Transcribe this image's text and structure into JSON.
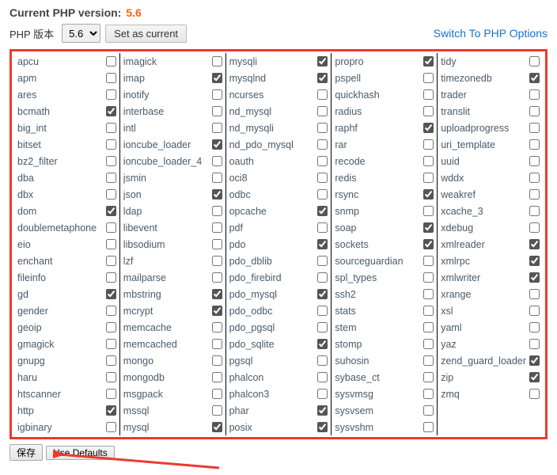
{
  "header": {
    "label": "Current PHP version:",
    "version": "5.6"
  },
  "second": {
    "label": "PHP 版本",
    "select_value": "5.6",
    "set_btn": "Set as current"
  },
  "switch_link": "Switch To PHP Options",
  "footer": {
    "save": "保存",
    "defaults": "Use Defaults"
  },
  "columns": [
    [
      {
        "name": "apcu",
        "checked": false
      },
      {
        "name": "apm",
        "checked": false
      },
      {
        "name": "ares",
        "checked": false
      },
      {
        "name": "bcmath",
        "checked": true
      },
      {
        "name": "big_int",
        "checked": false
      },
      {
        "name": "bitset",
        "checked": false
      },
      {
        "name": "bz2_filter",
        "checked": false
      },
      {
        "name": "dba",
        "checked": false
      },
      {
        "name": "dbx",
        "checked": false
      },
      {
        "name": "dom",
        "checked": true
      },
      {
        "name": "doublemetaphone",
        "checked": false
      },
      {
        "name": "eio",
        "checked": false
      },
      {
        "name": "enchant",
        "checked": false
      },
      {
        "name": "fileinfo",
        "checked": false
      },
      {
        "name": "gd",
        "checked": true
      },
      {
        "name": "gender",
        "checked": false
      },
      {
        "name": "geoip",
        "checked": false
      },
      {
        "name": "gmagick",
        "checked": false
      },
      {
        "name": "gnupg",
        "checked": false
      },
      {
        "name": "haru",
        "checked": false
      },
      {
        "name": "htscanner",
        "checked": false
      },
      {
        "name": "http",
        "checked": true
      },
      {
        "name": "igbinary",
        "checked": false
      }
    ],
    [
      {
        "name": "imagick",
        "checked": false
      },
      {
        "name": "imap",
        "checked": true
      },
      {
        "name": "inotify",
        "checked": false
      },
      {
        "name": "interbase",
        "checked": false
      },
      {
        "name": "intl",
        "checked": false
      },
      {
        "name": "ioncube_loader",
        "checked": true
      },
      {
        "name": "ioncube_loader_4",
        "checked": false
      },
      {
        "name": "jsmin",
        "checked": false
      },
      {
        "name": "json",
        "checked": true
      },
      {
        "name": "ldap",
        "checked": false
      },
      {
        "name": "libevent",
        "checked": false
      },
      {
        "name": "libsodium",
        "checked": false
      },
      {
        "name": "lzf",
        "checked": false
      },
      {
        "name": "mailparse",
        "checked": false
      },
      {
        "name": "mbstring",
        "checked": true
      },
      {
        "name": "mcrypt",
        "checked": true
      },
      {
        "name": "memcache",
        "checked": false
      },
      {
        "name": "memcached",
        "checked": false
      },
      {
        "name": "mongo",
        "checked": false
      },
      {
        "name": "mongodb",
        "checked": false
      },
      {
        "name": "msgpack",
        "checked": false
      },
      {
        "name": "mssql",
        "checked": false
      },
      {
        "name": "mysql",
        "checked": true
      }
    ],
    [
      {
        "name": "mysqli",
        "checked": true
      },
      {
        "name": "mysqlnd",
        "checked": true
      },
      {
        "name": "ncurses",
        "checked": false
      },
      {
        "name": "nd_mysql",
        "checked": false
      },
      {
        "name": "nd_mysqli",
        "checked": false
      },
      {
        "name": "nd_pdo_mysql",
        "checked": false
      },
      {
        "name": "oauth",
        "checked": false
      },
      {
        "name": "oci8",
        "checked": false
      },
      {
        "name": "odbc",
        "checked": false
      },
      {
        "name": "opcache",
        "checked": true
      },
      {
        "name": "pdf",
        "checked": false
      },
      {
        "name": "pdo",
        "checked": true
      },
      {
        "name": "pdo_dblib",
        "checked": false
      },
      {
        "name": "pdo_firebird",
        "checked": false
      },
      {
        "name": "pdo_mysql",
        "checked": true
      },
      {
        "name": "pdo_odbc",
        "checked": false
      },
      {
        "name": "pdo_pgsql",
        "checked": false
      },
      {
        "name": "pdo_sqlite",
        "checked": true
      },
      {
        "name": "pgsql",
        "checked": false
      },
      {
        "name": "phalcon",
        "checked": false
      },
      {
        "name": "phalcon3",
        "checked": false
      },
      {
        "name": "phar",
        "checked": true
      },
      {
        "name": "posix",
        "checked": true
      }
    ],
    [
      {
        "name": "propro",
        "checked": true
      },
      {
        "name": "pspell",
        "checked": false
      },
      {
        "name": "quickhash",
        "checked": false
      },
      {
        "name": "radius",
        "checked": false
      },
      {
        "name": "raphf",
        "checked": true
      },
      {
        "name": "rar",
        "checked": false
      },
      {
        "name": "recode",
        "checked": false
      },
      {
        "name": "redis",
        "checked": false
      },
      {
        "name": "rsync",
        "checked": true
      },
      {
        "name": "snmp",
        "checked": false
      },
      {
        "name": "soap",
        "checked": true
      },
      {
        "name": "sockets",
        "checked": true
      },
      {
        "name": "sourceguardian",
        "checked": false
      },
      {
        "name": "spl_types",
        "checked": false
      },
      {
        "name": "ssh2",
        "checked": false
      },
      {
        "name": "stats",
        "checked": false
      },
      {
        "name": "stem",
        "checked": false
      },
      {
        "name": "stomp",
        "checked": false
      },
      {
        "name": "suhosin",
        "checked": false
      },
      {
        "name": "sybase_ct",
        "checked": false
      },
      {
        "name": "sysvmsg",
        "checked": false
      },
      {
        "name": "sysvsem",
        "checked": false
      },
      {
        "name": "sysvshm",
        "checked": false
      }
    ],
    [
      {
        "name": "tidy",
        "checked": false
      },
      {
        "name": "timezonedb",
        "checked": true
      },
      {
        "name": "trader",
        "checked": false
      },
      {
        "name": "translit",
        "checked": false
      },
      {
        "name": "uploadprogress",
        "checked": false
      },
      {
        "name": "uri_template",
        "checked": false
      },
      {
        "name": "uuid",
        "checked": false
      },
      {
        "name": "wddx",
        "checked": false
      },
      {
        "name": "weakref",
        "checked": false
      },
      {
        "name": "xcache_3",
        "checked": false
      },
      {
        "name": "xdebug",
        "checked": false
      },
      {
        "name": "xmlreader",
        "checked": true
      },
      {
        "name": "xmlrpc",
        "checked": true
      },
      {
        "name": "xmlwriter",
        "checked": true
      },
      {
        "name": "xrange",
        "checked": false
      },
      {
        "name": "xsl",
        "checked": false
      },
      {
        "name": "yaml",
        "checked": false
      },
      {
        "name": "yaz",
        "checked": false
      },
      {
        "name": "zend_guard_loader",
        "checked": true
      },
      {
        "name": "zip",
        "checked": true
      },
      {
        "name": "zmq",
        "checked": false
      }
    ]
  ]
}
